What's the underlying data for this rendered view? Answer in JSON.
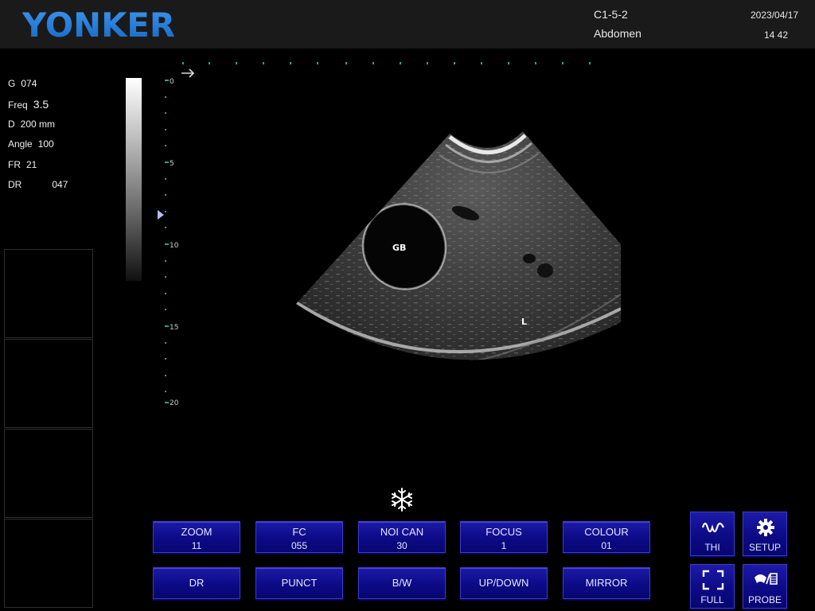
{
  "header": {
    "brand": "YONKER",
    "probe_code": "C1-5-2",
    "preset": "Abdomen",
    "date": "2023/04/17",
    "time": "14 42"
  },
  "params": [
    {
      "label": "G",
      "value": "074"
    },
    {
      "label": "Freq",
      "value": "3.5"
    },
    {
      "label": "D",
      "value": "200 mm"
    },
    {
      "label": "Angle",
      "value": "100"
    },
    {
      "label": "FR",
      "value": "21"
    },
    {
      "label": "DR",
      "value": "047"
    }
  ],
  "depth_scale": {
    "labels": [
      "0",
      "5",
      "10",
      "15",
      "20"
    ],
    "unit": "cm"
  },
  "image_annotations": {
    "gallbladder": "GB",
    "liver": "L"
  },
  "state": {
    "frozen": true
  },
  "controls": {
    "row1": [
      {
        "label": "ZOOM",
        "value": "11"
      },
      {
        "label": "FC",
        "value": "055"
      },
      {
        "label": "NOI CAN",
        "value": "30"
      },
      {
        "label": "FOCUS",
        "value": "1"
      },
      {
        "label": "COLOUR",
        "value": "01"
      }
    ],
    "row2": [
      {
        "label": "DR"
      },
      {
        "label": "PUNCT"
      },
      {
        "label": "B/W"
      },
      {
        "label": "UP/DOWN"
      },
      {
        "label": "MIRROR"
      }
    ],
    "side": [
      {
        "label": "THI",
        "icon": "thi-wave-icon"
      },
      {
        "label": "SETUP",
        "icon": "gear-icon"
      },
      {
        "label": "FULL",
        "icon": "fullscreen-icon"
      },
      {
        "label": "PROBE",
        "icon": "probe-icon"
      }
    ]
  },
  "colors": {
    "button_blue": "#0c0a86",
    "button_border": "#3d3ccf",
    "scale_tick": "#1fa890",
    "brand_blue": "#1a78d4"
  }
}
